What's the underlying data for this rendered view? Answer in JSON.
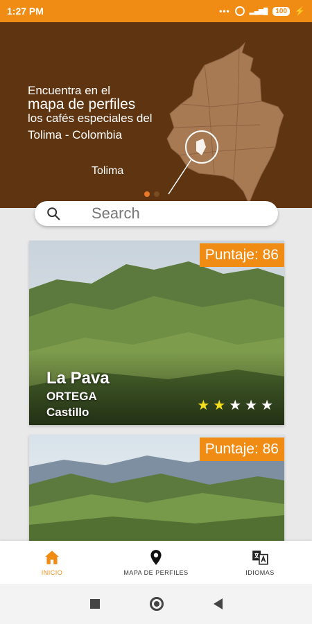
{
  "status_bar": {
    "time": "1:27 PM",
    "battery": "100",
    "icons": [
      "more-dots-icon",
      "alarm-icon",
      "signal-icon",
      "battery-icon",
      "charging-icon"
    ]
  },
  "banner": {
    "line1": "Encuentra en el",
    "line2": "mapa de perfiles",
    "line3": "los cafés especiales del",
    "line4": "Tolima - Colombia",
    "region_label": "Tolima",
    "background_color": "#5f3410",
    "map_color": "#a87a54"
  },
  "search": {
    "placeholder": "Search"
  },
  "cards": [
    {
      "score": "Puntaje: 86",
      "name": "La Pava",
      "municipality": "ORTEGA",
      "variety": "Castillo",
      "rating": 2,
      "max_rating": 5
    },
    {
      "score": "Puntaje: 86"
    }
  ],
  "bottom_nav": {
    "items": [
      {
        "label": "INICIO",
        "icon": "home-icon",
        "active": true
      },
      {
        "label": "MAPA DE PERFILES",
        "icon": "map-pin-icon",
        "active": false
      },
      {
        "label": "IDIOMAS",
        "icon": "translate-icon",
        "active": false
      }
    ]
  },
  "colors": {
    "accent": "#f08c14",
    "star_filled": "#f4e01c"
  }
}
